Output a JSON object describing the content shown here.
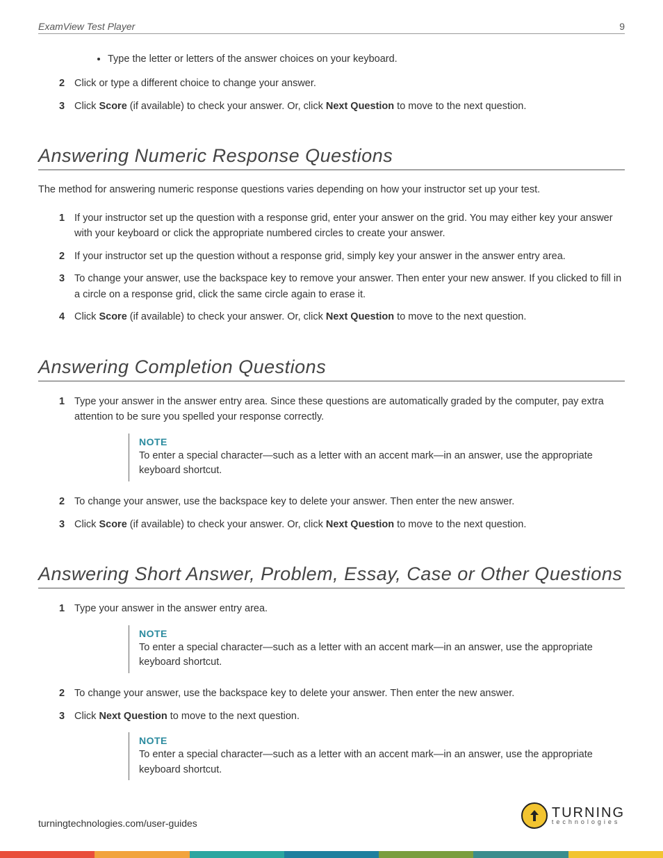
{
  "header": {
    "title": "ExamView Test Player",
    "page": "9"
  },
  "top": {
    "bullet": "Type the letter or letters of the answer choices on your keyboard.",
    "item2": "Click or type a different choice to change your answer.",
    "item3_pre": "Click ",
    "item3_b1": "Score",
    "item3_mid": " (if available) to check your answer. Or, click ",
    "item3_b2": "Next Question",
    "item3_post": " to move to the next question."
  },
  "numeric": {
    "heading": "Answering Numeric Response Questions",
    "intro": "The method for answering numeric response questions varies depending on how your instructor set up your test.",
    "i1": "If your instructor set up the question with a response grid, enter your answer on the grid. You may either key your answer with your keyboard or click the appropriate numbered circles to create your answer.",
    "i2": "If your instructor set up the question without a response grid, simply key your answer in the answer entry area.",
    "i3": "To change your answer, use the backspace key to remove your answer. Then enter your new answer. If you clicked to fill in a circle on a response grid, click the same circle again to erase it.",
    "i4_pre": "Click ",
    "i4_b1": "Score",
    "i4_mid": " (if available) to check your answer. Or, click ",
    "i4_b2": "Next Question",
    "i4_post": " to move to the next question."
  },
  "completion": {
    "heading": "Answering Completion Questions",
    "i1": "Type your answer in the answer entry area. Since these questions are automatically graded by the computer, pay extra attention to be sure you spelled your response correctly.",
    "note_label": "NOTE",
    "note_text": "To enter a special character—such as a letter with an accent mark—in an answer, use the appropriate keyboard shortcut.",
    "i2": "To change your answer, use the backspace key to delete your answer. Then enter the new answer.",
    "i3_pre": "Click ",
    "i3_b1": "Score",
    "i3_mid": " (if available) to check your answer. Or, click ",
    "i3_b2": "Next Question",
    "i3_post": " to move to the next question."
  },
  "short": {
    "heading": "Answering Short Answer, Problem, Essay, Case or Other Questions",
    "i1": "Type your answer in the answer entry area.",
    "note1_label": "NOTE",
    "note1_text": "To enter a special character—such as a letter with an accent mark—in an answer, use the appropriate keyboard shortcut.",
    "i2": "To change your answer, use the backspace key to delete your answer. Then enter the new answer.",
    "i3_pre": "Click ",
    "i3_b1": "Next Question",
    "i3_post": " to move to the next question.",
    "note2_label": "NOTE",
    "note2_text": "To enter a special character—such as a letter with an accent mark—in an answer, use the appropriate keyboard shortcut."
  },
  "footer": {
    "url": "turningtechnologies.com/user-guides",
    "logo_main": "TURNING",
    "logo_sub": "technologies"
  }
}
